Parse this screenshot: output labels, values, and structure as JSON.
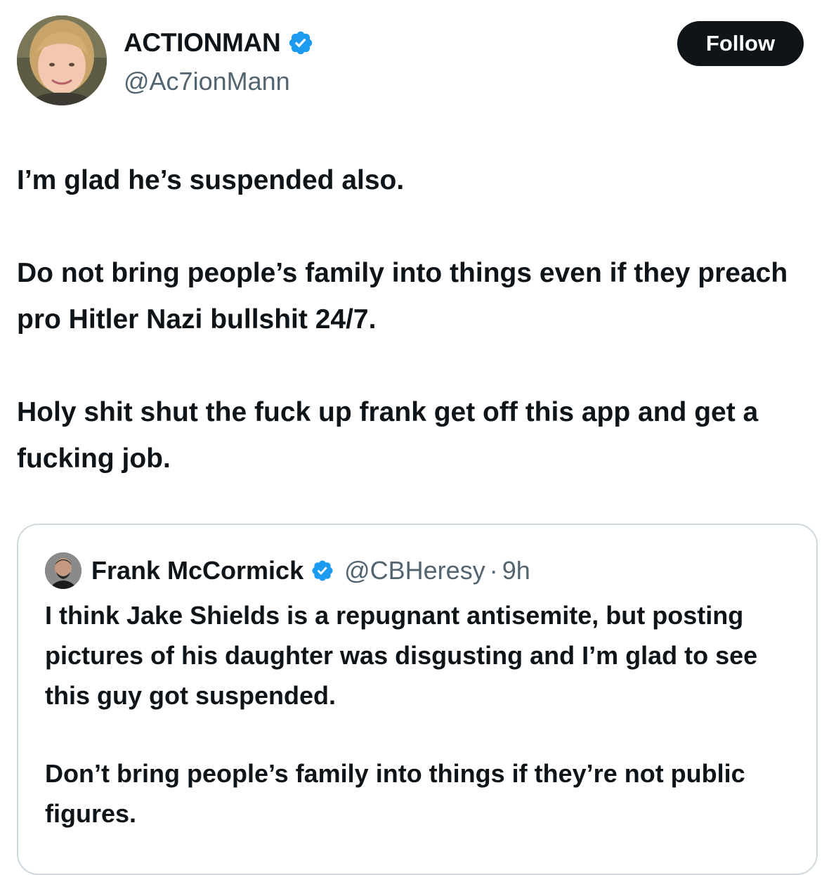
{
  "author": {
    "display_name": "ACTIONMAN",
    "handle": "@Ac7ionMann",
    "verified": true,
    "avatar_icon": "profile-photo"
  },
  "follow_button": {
    "label": "Follow"
  },
  "tweet": {
    "paragraphs": [
      "I’m glad he’s suspended also.",
      "Do not bring people’s family into things even if they preach pro Hitler Nazi bullshit 24/7.",
      "Holy shit shut the fuck up frank get off this app and get a fucking job."
    ]
  },
  "quoted_tweet": {
    "display_name": "Frank McCormick",
    "handle": "@CBHeresy",
    "separator": "·",
    "time": "9h",
    "verified": true,
    "paragraphs": [
      "I think Jake Shields is a repugnant antisemite, but posting pictures of his daughter was disgusting and I’m glad to see this guy got suspended.",
      "Don’t bring people’s family into things if they’re not public figures."
    ]
  },
  "colors": {
    "text_primary": "#0f1419",
    "text_secondary": "#536471",
    "verified_blue": "#1d9bf0",
    "border": "#cfd9de",
    "follow_bg": "#0f1419"
  }
}
